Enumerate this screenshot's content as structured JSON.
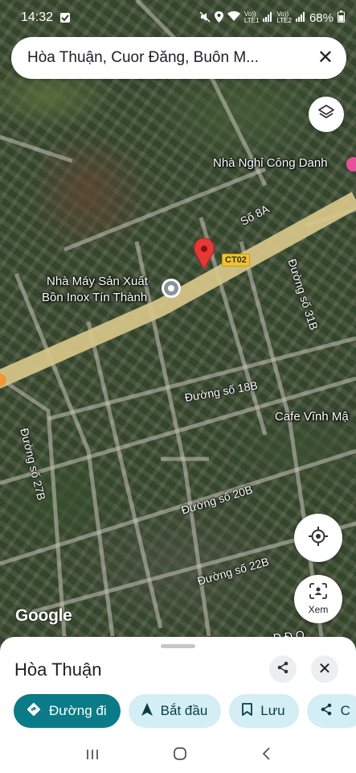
{
  "status_bar": {
    "time": "14:32",
    "network_1": "Vo))\nLTE1",
    "network_2": "Vo))\nLTE2",
    "battery": "68%"
  },
  "search": {
    "query": "Hòa Thuận, Cuor Đăng, Buôn M..."
  },
  "map": {
    "labels": {
      "guesthouse": "Nhà Nghỉ Công Danh",
      "factory_line1": "Nhà Máy Sản Xuất",
      "factory_line2": "Bồn Inox Tín Thành",
      "cafe": "Cafe Vĩnh Mậ"
    },
    "roads": {
      "so_8a": "Số 8A",
      "ct02": "CT02",
      "duong_31b": "Đường số 31B",
      "duong_18b": "Đường số 18B",
      "duong_27b": "Đường số 27B",
      "duong_20b": "Đường số 20B",
      "duong_22b": "Đường số 22B",
      "partial_bottom": "Đ   Đ   Q"
    },
    "logo": "Google"
  },
  "controls": {
    "view_label": "Xem"
  },
  "sheet": {
    "title": "Hòa Thuận",
    "chips": [
      {
        "label": "Đường đi",
        "icon": "directions-icon"
      },
      {
        "label": "Bắt đầu",
        "icon": "navigation-arrow-icon"
      },
      {
        "label": "Lưu",
        "icon": "bookmark-icon"
      },
      {
        "label": "C",
        "icon": "share-icon"
      }
    ]
  },
  "colors": {
    "primary_chip": "#0b7b87",
    "secondary_chip": "#d3eef4",
    "pin": "#e53935",
    "main_road": "#d8c78a"
  }
}
